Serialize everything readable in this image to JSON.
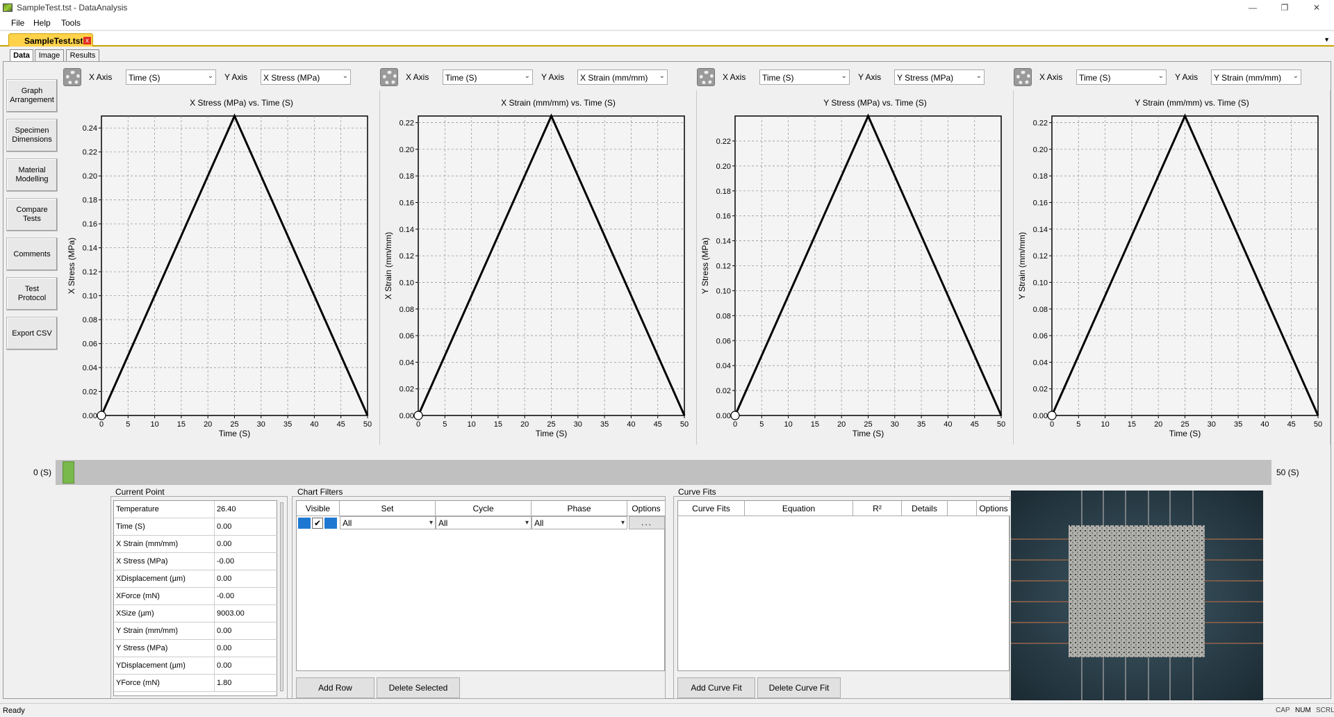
{
  "window": {
    "title": "SampleTest.tst - DataAnalysis",
    "minimize": "—",
    "restore": "❐",
    "close": "✕"
  },
  "menu": [
    "File",
    "Help",
    "Tools"
  ],
  "doc_tab": {
    "label": "SampleTest.tst",
    "close": "x",
    "dropdown": "▼"
  },
  "subtabs": [
    "Data",
    "Image",
    "Results"
  ],
  "sidebar": [
    "Graph\nArrangement",
    "Specimen\nDimensions",
    "Material\nModelling",
    "Compare\nTests",
    "Comments",
    "Test\nProtocol",
    "Export CSV"
  ],
  "axis_controls": [
    {
      "x_label": "X Axis",
      "x_value": "Time (S)",
      "y_label": "Y Axis",
      "y_value": "X Stress (MPa)"
    },
    {
      "x_label": "X Axis",
      "x_value": "Time (S)",
      "y_label": "Y Axis",
      "y_value": "X Strain (mm/mm)"
    },
    {
      "x_label": "X Axis",
      "x_value": "Time (S)",
      "y_label": "Y Axis",
      "y_value": "Y Stress (MPa)"
    },
    {
      "x_label": "X Axis",
      "x_value": "Time (S)",
      "y_label": "Y Axis",
      "y_value": "Y Strain (mm/mm)"
    }
  ],
  "chart_data": [
    {
      "type": "line",
      "title": "X Stress (MPa) vs. Time (S)",
      "xlabel": "Time (S)",
      "ylabel": "X Stress (MPa)",
      "xlim": [
        0,
        50
      ],
      "ylim": [
        0,
        0.25
      ],
      "xticks": [
        "0",
        "5",
        "10",
        "15",
        "20",
        "25",
        "30",
        "35",
        "40",
        "45",
        "50"
      ],
      "yticks": [
        "0.00",
        "0.02",
        "0.04",
        "0.06",
        "0.08",
        "0.10",
        "0.12",
        "0.14",
        "0.16",
        "0.18",
        "0.20",
        "0.22",
        "0.24"
      ],
      "ytick_values": [
        0,
        0.02,
        0.04,
        0.06,
        0.08,
        0.1,
        0.12,
        0.14,
        0.16,
        0.18,
        0.2,
        0.22,
        0.24
      ],
      "grid": true,
      "x": [
        0,
        25,
        50
      ],
      "y": [
        0,
        0.25,
        0
      ]
    },
    {
      "type": "line",
      "title": "X Strain (mm/mm) vs. Time (S)",
      "xlabel": "Time (S)",
      "ylabel": "X Strain (mm/mm)",
      "xlim": [
        0,
        50
      ],
      "ylim": [
        0,
        0.225
      ],
      "xticks": [
        "0",
        "5",
        "10",
        "15",
        "20",
        "25",
        "30",
        "35",
        "40",
        "45",
        "50"
      ],
      "yticks": [
        "0.00",
        "0.02",
        "0.04",
        "0.06",
        "0.08",
        "0.10",
        "0.12",
        "0.14",
        "0.16",
        "0.18",
        "0.20",
        "0.22"
      ],
      "ytick_values": [
        0,
        0.02,
        0.04,
        0.06,
        0.08,
        0.1,
        0.12,
        0.14,
        0.16,
        0.18,
        0.2,
        0.22
      ],
      "grid": true,
      "x": [
        0,
        25,
        50
      ],
      "y": [
        0,
        0.225,
        0
      ]
    },
    {
      "type": "line",
      "title": "Y Stress (MPa) vs. Time (S)",
      "xlabel": "Time (S)",
      "ylabel": "Y Stress (MPa)",
      "xlim": [
        0,
        50
      ],
      "ylim": [
        0,
        0.24
      ],
      "xticks": [
        "0",
        "5",
        "10",
        "15",
        "20",
        "25",
        "30",
        "35",
        "40",
        "45",
        "50"
      ],
      "yticks": [
        "0.00",
        "0.02",
        "0.04",
        "0.06",
        "0.08",
        "0.10",
        "0.12",
        "0.14",
        "0.16",
        "0.18",
        "0.20",
        "0.22"
      ],
      "ytick_values": [
        0,
        0.02,
        0.04,
        0.06,
        0.08,
        0.1,
        0.12,
        0.14,
        0.16,
        0.18,
        0.2,
        0.22
      ],
      "grid": true,
      "x": [
        0,
        25,
        50
      ],
      "y": [
        0,
        0.24,
        0
      ]
    },
    {
      "type": "line",
      "title": "Y Strain (mm/mm) vs. Time (S)",
      "xlabel": "Time (S)",
      "ylabel": "Y Strain (mm/mm)",
      "xlim": [
        0,
        50
      ],
      "ylim": [
        0,
        0.225
      ],
      "xticks": [
        "0",
        "5",
        "10",
        "15",
        "20",
        "25",
        "30",
        "35",
        "40",
        "45",
        "50"
      ],
      "yticks": [
        "0.00",
        "0.02",
        "0.04",
        "0.06",
        "0.08",
        "0.10",
        "0.12",
        "0.14",
        "0.16",
        "0.18",
        "0.20",
        "0.22"
      ],
      "ytick_values": [
        0,
        0.02,
        0.04,
        0.06,
        0.08,
        0.1,
        0.12,
        0.14,
        0.16,
        0.18,
        0.2,
        0.22
      ],
      "grid": true,
      "x": [
        0,
        25,
        50
      ],
      "y": [
        0,
        0.225,
        0
      ]
    }
  ],
  "timeline": {
    "start": "0 (S)",
    "end": "50 (S)",
    "position": 0
  },
  "current_point": {
    "title": "Current Point",
    "rows": [
      [
        "Temperature",
        "26.40"
      ],
      [
        "Time (S)",
        "0.00"
      ],
      [
        "X Strain (mm/mm)",
        "0.00"
      ],
      [
        "X Stress (MPa)",
        "-0.00"
      ],
      [
        "XDisplacement (µm)",
        "0.00"
      ],
      [
        "XForce (mN)",
        "-0.00"
      ],
      [
        "XSize (µm)",
        "9003.00"
      ],
      [
        "Y Strain (mm/mm)",
        "0.00"
      ],
      [
        "Y Stress (MPa)",
        "0.00"
      ],
      [
        "YDisplacement (µm)",
        "0.00"
      ],
      [
        "YForce (mN)",
        "1.80"
      ]
    ]
  },
  "chart_filters": {
    "title": "Chart Filters",
    "headers": [
      "Visible",
      "Set",
      "Cycle",
      "Phase",
      "Options"
    ],
    "row": {
      "set": "All",
      "cycle": "All",
      "phase": "All",
      "options": "..."
    },
    "add_row": "Add Row",
    "delete_selected": "Delete Selected"
  },
  "curve_fits": {
    "title": "Curve Fits",
    "headers": [
      "Curve Fits",
      "Equation",
      "R²",
      "Details",
      "",
      "Options"
    ],
    "add": "Add Curve Fit",
    "delete": "Delete Curve Fit"
  },
  "status": {
    "left": "Ready",
    "cap": "CAP",
    "num": "NUM",
    "scrl": "SCRL"
  },
  "colors": {
    "tab": "#ffd24a",
    "thumb": "#79b94b",
    "blue": "#1e78d2"
  }
}
